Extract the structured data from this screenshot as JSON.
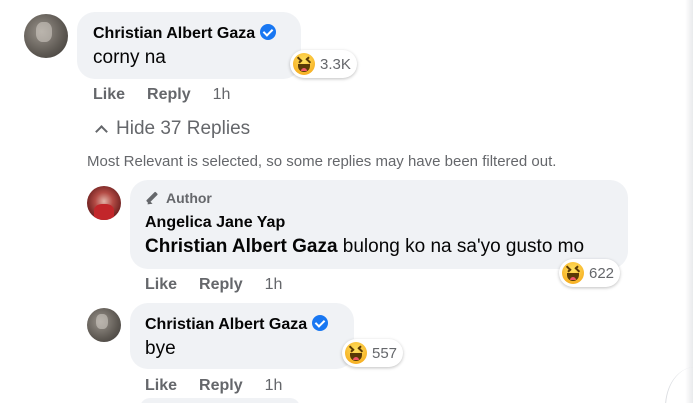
{
  "comment": {
    "author": "Christian Albert Gaza",
    "text": "corny na",
    "reaction_count": "3.3K",
    "like_label": "Like",
    "reply_label": "Reply",
    "time": "1h"
  },
  "replies_toggle": {
    "label": "Hide 37 Replies"
  },
  "filter_notice": "Most Relevant is selected, so some replies may have been filtered out.",
  "replies": [
    {
      "badge": "Author",
      "author": "Angelica Jane Yap",
      "mention": "Christian Albert Gaza",
      "text": " bulong ko na sa'yo gusto mo",
      "reaction_count": "622",
      "like_label": "Like",
      "reply_label": "Reply",
      "time": "1h"
    },
    {
      "author": "Christian Albert Gaza",
      "text": "bye",
      "reaction_count": "557",
      "like_label": "Like",
      "reply_label": "Reply",
      "time": "1h"
    }
  ],
  "colors": {
    "bubble": "#f0f2f5",
    "verified": "#1877f2",
    "muted_text": "#65676b"
  },
  "icons": [
    "verified-badge-icon",
    "haha-reaction-icon",
    "chevron-up-icon",
    "pencil-icon"
  ]
}
